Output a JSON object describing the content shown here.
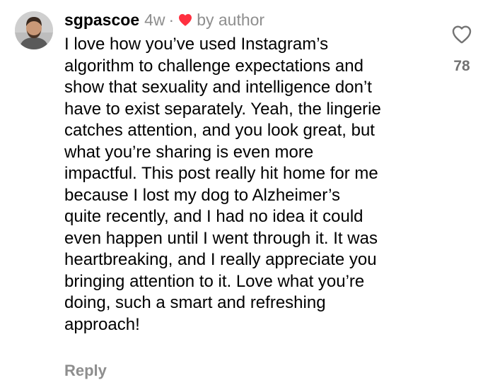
{
  "comment": {
    "username": "sgpascoe",
    "time_ago": "4w",
    "separator": "·",
    "author_badge": "by author",
    "text_lines": [
      "I love how you’ve used Instagram’s",
      "algorithm to challenge expectations and",
      "show that sexuality and intelligence don’t",
      "have to exist separately. Yeah, the lingerie",
      "catches attention, and you look great, but",
      "what you’re sharing is even more",
      "impactful. This post really hit home for me",
      "because I lost my dog to Alzheimer’s",
      "quite recently, and I had no idea it could",
      "even happen until I went through it. It was",
      "heartbreaking, and I really appreciate you",
      "bringing attention to it. Love what you’re",
      "doing, such a smart and refreshing",
      "approach!"
    ],
    "reply_label": "Reply",
    "like_count": "78"
  },
  "colors": {
    "muted": "#8e8e8e",
    "heart_red": "#ff3040",
    "text": "#000000"
  },
  "icons": {
    "author_heart": "heart-filled-icon",
    "like": "heart-outline-icon",
    "avatar": "avatar"
  }
}
